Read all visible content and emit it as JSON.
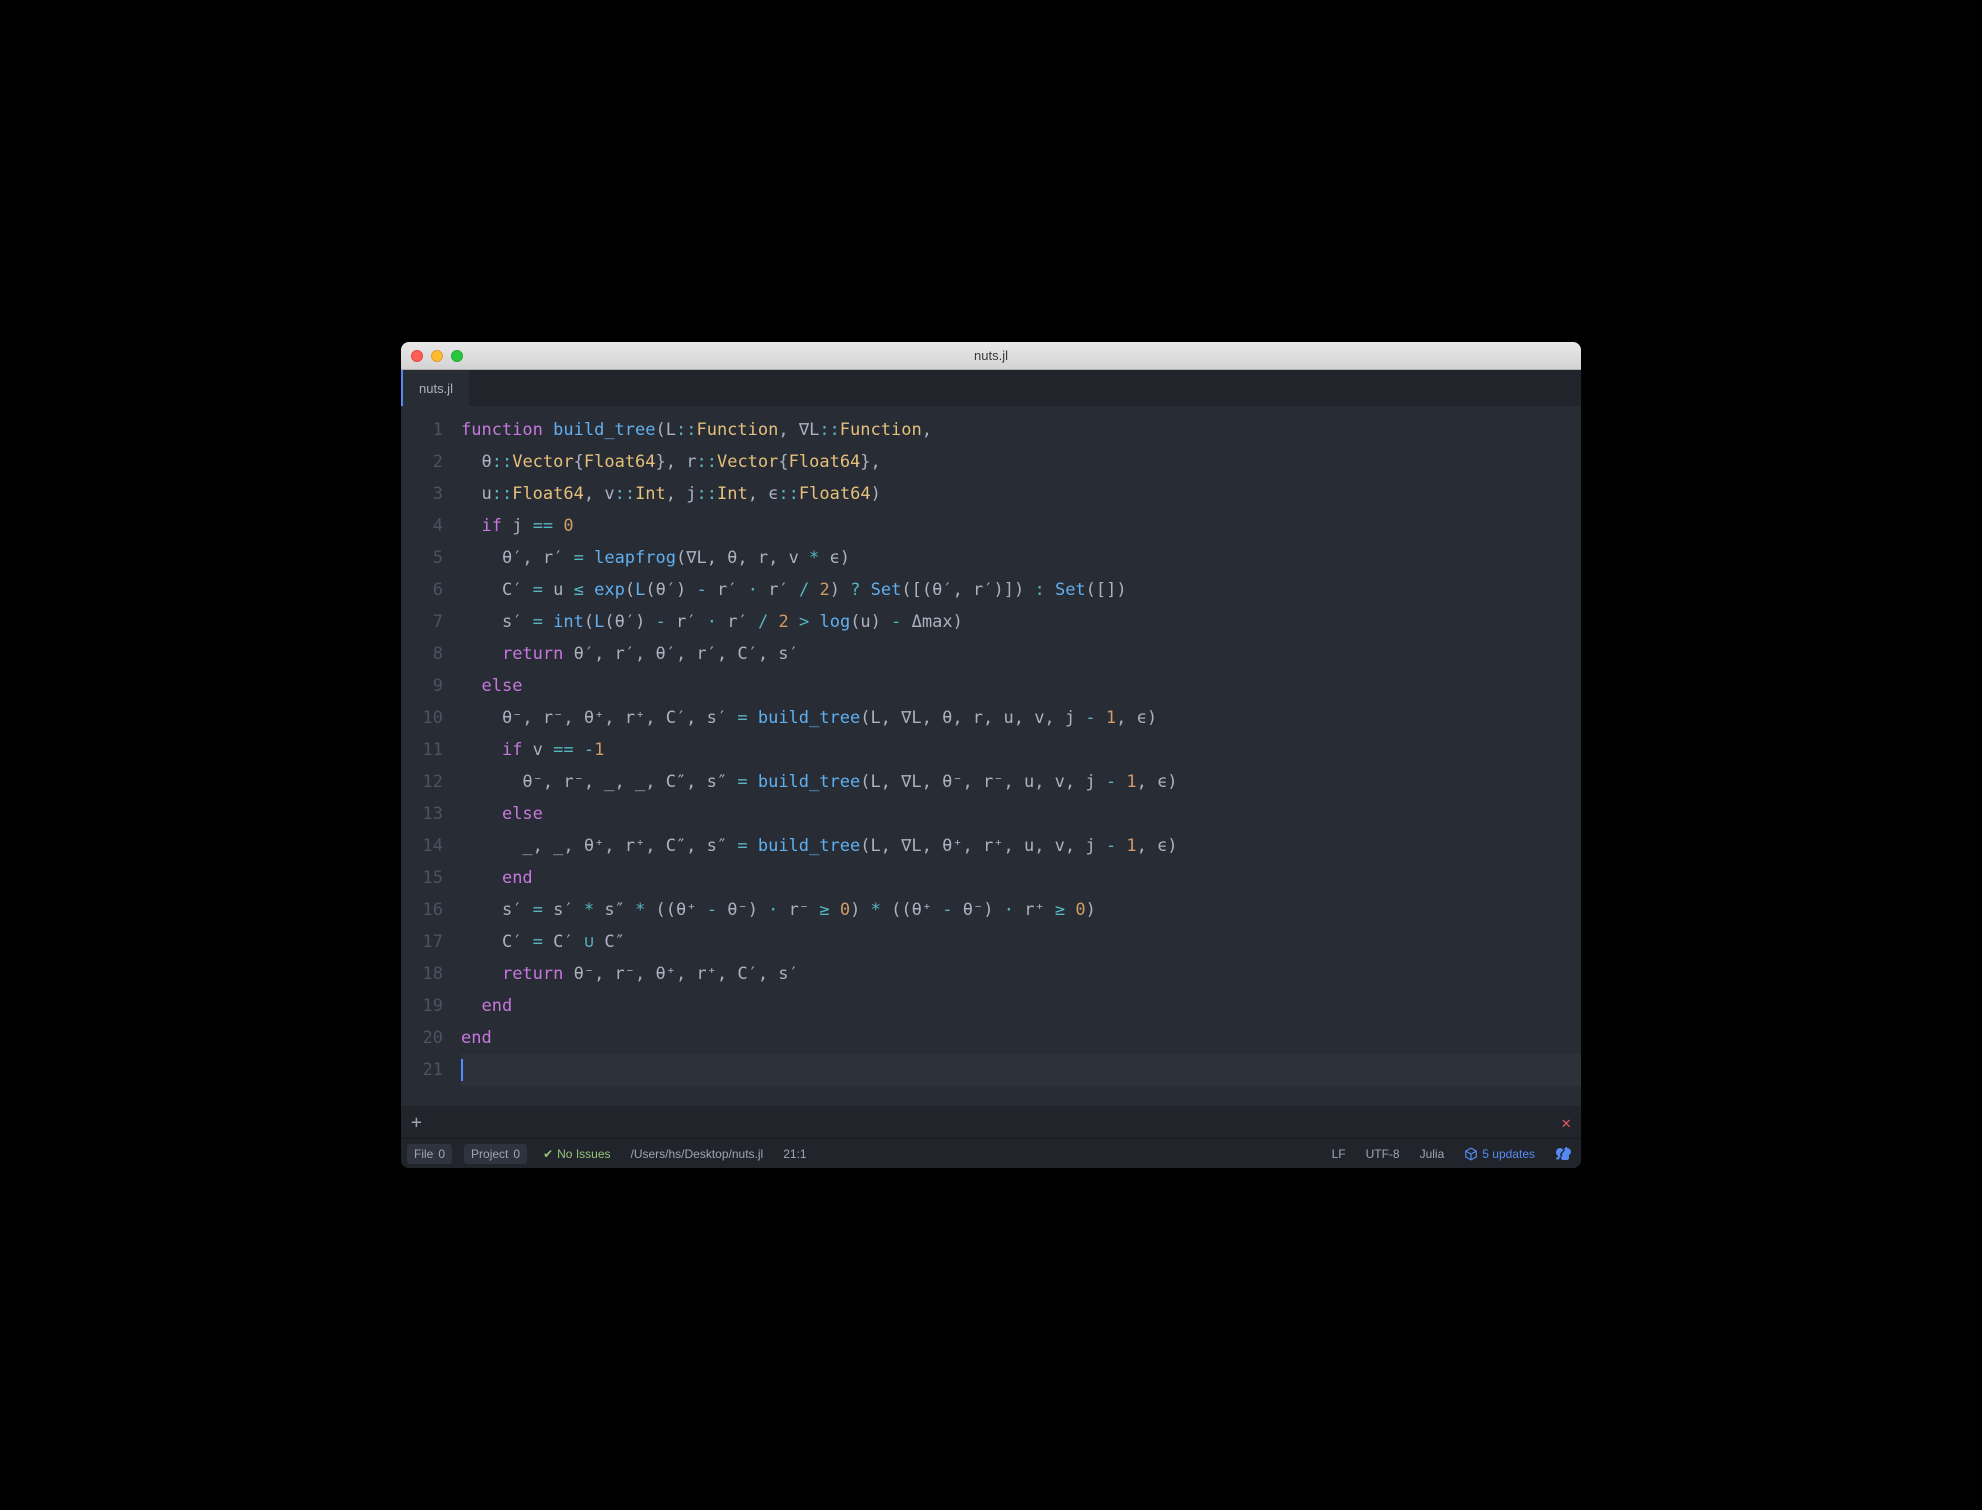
{
  "window": {
    "title": "nuts.jl"
  },
  "tab": {
    "label": "nuts.jl"
  },
  "code": {
    "total_lines": 21,
    "cursor_line": 21,
    "lines": [
      [
        {
          "c": "kw",
          "t": "function"
        },
        {
          "c": "punc",
          "t": " "
        },
        {
          "c": "fn",
          "t": "build_tree"
        },
        {
          "c": "punc",
          "t": "(L"
        },
        {
          "c": "op",
          "t": "::"
        },
        {
          "c": "ty",
          "t": "Function"
        },
        {
          "c": "punc",
          "t": ", ∇L"
        },
        {
          "c": "op",
          "t": "::"
        },
        {
          "c": "ty",
          "t": "Function"
        },
        {
          "c": "punc",
          "t": ","
        }
      ],
      [
        {
          "c": "punc",
          "t": "  θ"
        },
        {
          "c": "op",
          "t": "::"
        },
        {
          "c": "ty",
          "t": "Vector"
        },
        {
          "c": "punc",
          "t": "{"
        },
        {
          "c": "ty",
          "t": "Float64"
        },
        {
          "c": "punc",
          "t": "}, r"
        },
        {
          "c": "op",
          "t": "::"
        },
        {
          "c": "ty",
          "t": "Vector"
        },
        {
          "c": "punc",
          "t": "{"
        },
        {
          "c": "ty",
          "t": "Float64"
        },
        {
          "c": "punc",
          "t": "},"
        }
      ],
      [
        {
          "c": "punc",
          "t": "  u"
        },
        {
          "c": "op",
          "t": "::"
        },
        {
          "c": "ty",
          "t": "Float64"
        },
        {
          "c": "punc",
          "t": ", v"
        },
        {
          "c": "op",
          "t": "::"
        },
        {
          "c": "ty",
          "t": "Int"
        },
        {
          "c": "punc",
          "t": ", j"
        },
        {
          "c": "op",
          "t": "::"
        },
        {
          "c": "ty",
          "t": "Int"
        },
        {
          "c": "punc",
          "t": ", ϵ"
        },
        {
          "c": "op",
          "t": "::"
        },
        {
          "c": "ty",
          "t": "Float64"
        },
        {
          "c": "punc",
          "t": ")"
        }
      ],
      [
        {
          "c": "punc",
          "t": "  "
        },
        {
          "c": "kw",
          "t": "if"
        },
        {
          "c": "punc",
          "t": " j "
        },
        {
          "c": "op",
          "t": "=="
        },
        {
          "c": "punc",
          "t": " "
        },
        {
          "c": "num",
          "t": "0"
        }
      ],
      [
        {
          "c": "punc",
          "t": "    θ′, r′ "
        },
        {
          "c": "op",
          "t": "="
        },
        {
          "c": "punc",
          "t": " "
        },
        {
          "c": "fn",
          "t": "leapfrog"
        },
        {
          "c": "punc",
          "t": "(∇L, θ, r, v "
        },
        {
          "c": "op",
          "t": "*"
        },
        {
          "c": "punc",
          "t": " ϵ)"
        }
      ],
      [
        {
          "c": "punc",
          "t": "    C′ "
        },
        {
          "c": "op",
          "t": "="
        },
        {
          "c": "punc",
          "t": " u "
        },
        {
          "c": "op",
          "t": "≤"
        },
        {
          "c": "punc",
          "t": " "
        },
        {
          "c": "fn",
          "t": "exp"
        },
        {
          "c": "punc",
          "t": "("
        },
        {
          "c": "fn",
          "t": "L"
        },
        {
          "c": "punc",
          "t": "(θ′) "
        },
        {
          "c": "op",
          "t": "-"
        },
        {
          "c": "punc",
          "t": " r′ "
        },
        {
          "c": "op",
          "t": "⋅"
        },
        {
          "c": "punc",
          "t": " r′ "
        },
        {
          "c": "op",
          "t": "/"
        },
        {
          "c": "punc",
          "t": " "
        },
        {
          "c": "num",
          "t": "2"
        },
        {
          "c": "punc",
          "t": ") "
        },
        {
          "c": "op",
          "t": "?"
        },
        {
          "c": "punc",
          "t": " "
        },
        {
          "c": "fn",
          "t": "Set"
        },
        {
          "c": "punc",
          "t": "([(θ′, r′)]) "
        },
        {
          "c": "op",
          "t": ":"
        },
        {
          "c": "punc",
          "t": " "
        },
        {
          "c": "fn",
          "t": "Set"
        },
        {
          "c": "punc",
          "t": "([])"
        }
      ],
      [
        {
          "c": "punc",
          "t": "    s′ "
        },
        {
          "c": "op",
          "t": "="
        },
        {
          "c": "punc",
          "t": " "
        },
        {
          "c": "fn",
          "t": "int"
        },
        {
          "c": "punc",
          "t": "("
        },
        {
          "c": "fn",
          "t": "L"
        },
        {
          "c": "punc",
          "t": "(θ′) "
        },
        {
          "c": "op",
          "t": "-"
        },
        {
          "c": "punc",
          "t": " r′ "
        },
        {
          "c": "op",
          "t": "⋅"
        },
        {
          "c": "punc",
          "t": " r′ "
        },
        {
          "c": "op",
          "t": "/"
        },
        {
          "c": "punc",
          "t": " "
        },
        {
          "c": "num",
          "t": "2"
        },
        {
          "c": "punc",
          "t": " "
        },
        {
          "c": "op",
          "t": ">"
        },
        {
          "c": "punc",
          "t": " "
        },
        {
          "c": "fn",
          "t": "log"
        },
        {
          "c": "punc",
          "t": "(u) "
        },
        {
          "c": "op",
          "t": "-"
        },
        {
          "c": "punc",
          "t": " Δmax)"
        }
      ],
      [
        {
          "c": "punc",
          "t": "    "
        },
        {
          "c": "kw",
          "t": "return"
        },
        {
          "c": "punc",
          "t": " θ′, r′, θ′, r′, C′, s′"
        }
      ],
      [
        {
          "c": "punc",
          "t": "  "
        },
        {
          "c": "kw",
          "t": "else"
        }
      ],
      [
        {
          "c": "punc",
          "t": "    θ⁻, r⁻, θ⁺, r⁺, C′, s′ "
        },
        {
          "c": "op",
          "t": "="
        },
        {
          "c": "punc",
          "t": " "
        },
        {
          "c": "fn",
          "t": "build_tree"
        },
        {
          "c": "punc",
          "t": "(L, ∇L, θ, r, u, v, j "
        },
        {
          "c": "op",
          "t": "-"
        },
        {
          "c": "punc",
          "t": " "
        },
        {
          "c": "num",
          "t": "1"
        },
        {
          "c": "punc",
          "t": ", ϵ)"
        }
      ],
      [
        {
          "c": "punc",
          "t": "    "
        },
        {
          "c": "kw",
          "t": "if"
        },
        {
          "c": "punc",
          "t": " v "
        },
        {
          "c": "op",
          "t": "=="
        },
        {
          "c": "punc",
          "t": " "
        },
        {
          "c": "op",
          "t": "-"
        },
        {
          "c": "num",
          "t": "1"
        }
      ],
      [
        {
          "c": "punc",
          "t": "      θ⁻, r⁻, _, _, C″, s″ "
        },
        {
          "c": "op",
          "t": "="
        },
        {
          "c": "punc",
          "t": " "
        },
        {
          "c": "fn",
          "t": "build_tree"
        },
        {
          "c": "punc",
          "t": "(L, ∇L, θ⁻, r⁻, u, v, j "
        },
        {
          "c": "op",
          "t": "-"
        },
        {
          "c": "punc",
          "t": " "
        },
        {
          "c": "num",
          "t": "1"
        },
        {
          "c": "punc",
          "t": ", ϵ)"
        }
      ],
      [
        {
          "c": "punc",
          "t": "    "
        },
        {
          "c": "kw",
          "t": "else"
        }
      ],
      [
        {
          "c": "punc",
          "t": "      _, _, θ⁺, r⁺, C″, s″ "
        },
        {
          "c": "op",
          "t": "="
        },
        {
          "c": "punc",
          "t": " "
        },
        {
          "c": "fn",
          "t": "build_tree"
        },
        {
          "c": "punc",
          "t": "(L, ∇L, θ⁺, r⁺, u, v, j "
        },
        {
          "c": "op",
          "t": "-"
        },
        {
          "c": "punc",
          "t": " "
        },
        {
          "c": "num",
          "t": "1"
        },
        {
          "c": "punc",
          "t": ", ϵ)"
        }
      ],
      [
        {
          "c": "punc",
          "t": "    "
        },
        {
          "c": "kw",
          "t": "end"
        }
      ],
      [
        {
          "c": "punc",
          "t": "    s′ "
        },
        {
          "c": "op",
          "t": "="
        },
        {
          "c": "punc",
          "t": " s′ "
        },
        {
          "c": "op",
          "t": "*"
        },
        {
          "c": "punc",
          "t": " s″ "
        },
        {
          "c": "op",
          "t": "*"
        },
        {
          "c": "punc",
          "t": " ((θ⁺ "
        },
        {
          "c": "op",
          "t": "-"
        },
        {
          "c": "punc",
          "t": " θ⁻) "
        },
        {
          "c": "op",
          "t": "⋅"
        },
        {
          "c": "punc",
          "t": " r⁻ "
        },
        {
          "c": "op",
          "t": "≥"
        },
        {
          "c": "punc",
          "t": " "
        },
        {
          "c": "num",
          "t": "0"
        },
        {
          "c": "punc",
          "t": ") "
        },
        {
          "c": "op",
          "t": "*"
        },
        {
          "c": "punc",
          "t": " ((θ⁺ "
        },
        {
          "c": "op",
          "t": "-"
        },
        {
          "c": "punc",
          "t": " θ⁻) "
        },
        {
          "c": "op",
          "t": "⋅"
        },
        {
          "c": "punc",
          "t": " r⁺ "
        },
        {
          "c": "op",
          "t": "≥"
        },
        {
          "c": "punc",
          "t": " "
        },
        {
          "c": "num",
          "t": "0"
        },
        {
          "c": "punc",
          "t": ")"
        }
      ],
      [
        {
          "c": "punc",
          "t": "    C′ "
        },
        {
          "c": "op",
          "t": "="
        },
        {
          "c": "punc",
          "t": " C′ "
        },
        {
          "c": "op",
          "t": "∪"
        },
        {
          "c": "punc",
          "t": " C″"
        }
      ],
      [
        {
          "c": "punc",
          "t": "    "
        },
        {
          "c": "kw",
          "t": "return"
        },
        {
          "c": "punc",
          "t": " θ⁻, r⁻, θ⁺, r⁺, C′, s′"
        }
      ],
      [
        {
          "c": "punc",
          "t": "  "
        },
        {
          "c": "kw",
          "t": "end"
        }
      ],
      [
        {
          "c": "kw",
          "t": "end"
        }
      ],
      []
    ]
  },
  "status": {
    "file_label": "File",
    "file_count": "0",
    "project_label": "Project",
    "project_count": "0",
    "issues": "No Issues",
    "path": "/Users/hs/Desktop/nuts.jl",
    "cursor": "21:1",
    "line_ending": "LF",
    "encoding": "UTF-8",
    "language": "Julia",
    "updates": "5 updates"
  }
}
